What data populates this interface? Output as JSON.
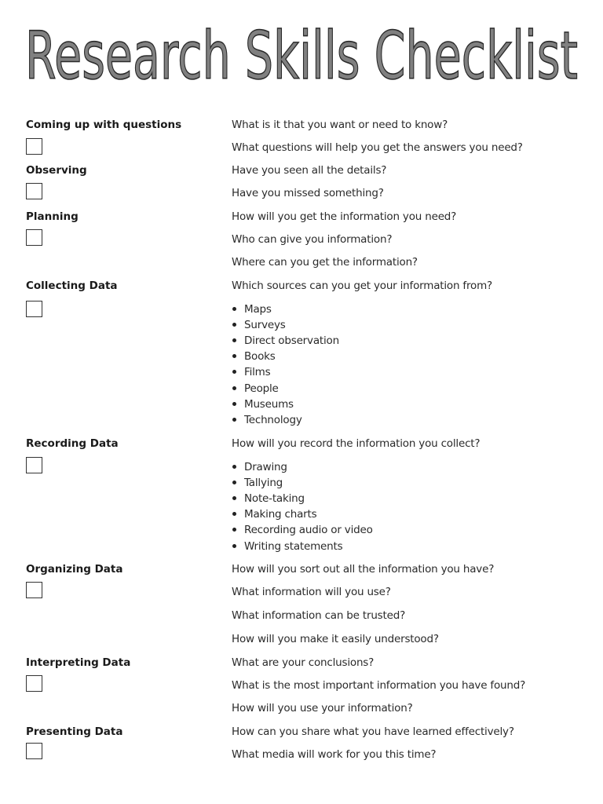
{
  "title": "Research Skills Checklist",
  "sections": [
    {
      "label": "Coming up with questions",
      "checked": false,
      "questions": [
        "What is it that you want or need to know?",
        "What questions will help you get the answers you need?"
      ]
    },
    {
      "label": "Observing",
      "checked": false,
      "questions": [
        "Have you seen all the details?",
        "Have you missed something?"
      ]
    },
    {
      "label": "Planning",
      "checked": false,
      "questions": [
        "How will you get the information you need?",
        "Who can give you information?",
        "Where can you get the information?"
      ]
    },
    {
      "label": "Collecting Data",
      "checked": false,
      "questions": [
        "Which sources can you get your information from?"
      ],
      "bullets": [
        "Maps",
        "Surveys",
        "Direct observation",
        "Books",
        "Films",
        "People",
        "Museums",
        "Technology"
      ]
    },
    {
      "label": "Recording Data",
      "checked": false,
      "questions": [
        "How will you record the information you collect?"
      ],
      "bullets": [
        "Drawing",
        "Tallying",
        "Note-taking",
        "Making charts",
        "Recording audio or video",
        "Writing statements"
      ]
    },
    {
      "label": "Organizing Data",
      "checked": false,
      "questions": [
        "How will you sort out all the information you have?",
        "What information will you use?",
        "What information can be trusted?",
        "How will you make it easily understood?"
      ]
    },
    {
      "label": "Interpreting Data",
      "checked": false,
      "questions": [
        "What are your conclusions?",
        "What is the most important information you have found?",
        "How will you use your information?"
      ]
    },
    {
      "label": "Presenting Data",
      "checked": false,
      "questions": [
        "How can you share what you have learned effectively?",
        "What media will work for you this time?"
      ]
    }
  ]
}
